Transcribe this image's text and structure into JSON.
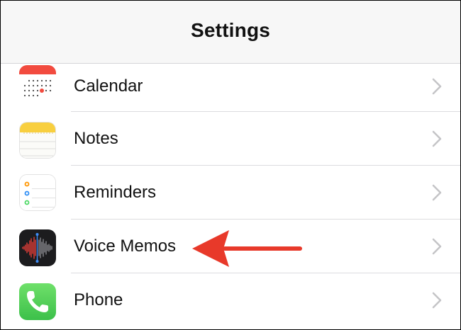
{
  "navbar": {
    "title": "Settings"
  },
  "rows": [
    {
      "label": "Calendar",
      "icon": "calendar-icon"
    },
    {
      "label": "Notes",
      "icon": "notes-icon"
    },
    {
      "label": "Reminders",
      "icon": "reminders-icon"
    },
    {
      "label": "Voice Memos",
      "icon": "voice-memos-icon"
    },
    {
      "label": "Phone",
      "icon": "phone-icon"
    }
  ],
  "colors": {
    "navbar_bg": "#f7f7f7",
    "separator": "#dcdcdf",
    "chevron": "#c4c4c7",
    "arrow": "#e8392a",
    "calendar_red": "#f24b3f",
    "notes_yellow": "#f8cf3f",
    "phone_green": "#5ad35a",
    "voice_bg": "#1c1c1e"
  },
  "annotation": {
    "type": "arrow",
    "points_to": "Voice Memos"
  }
}
